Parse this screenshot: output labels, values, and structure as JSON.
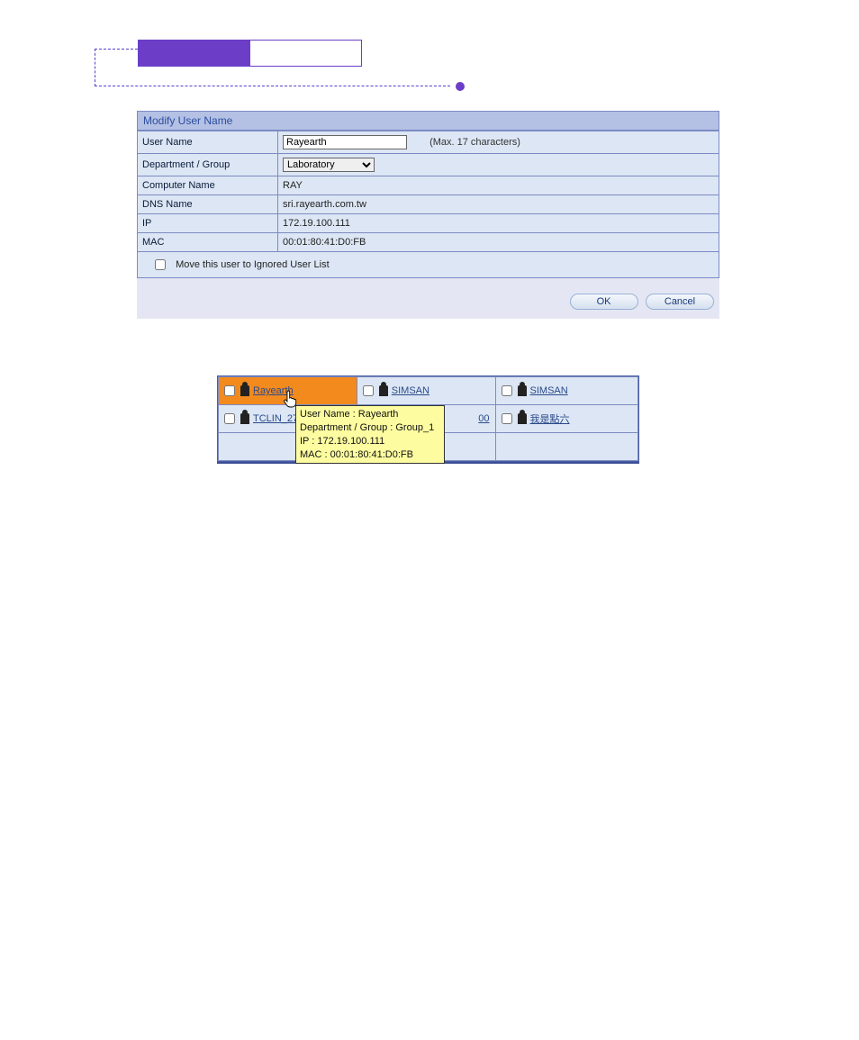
{
  "panel": {
    "title": "Modify User Name",
    "rows": {
      "user_name_label": "User Name",
      "user_name_value": "Rayearth",
      "user_name_hint": "(Max. 17 characters)",
      "dept_label": "Department / Group",
      "dept_value": "Laboratory",
      "computer_label": "Computer Name",
      "computer_value": "RAY",
      "dns_label": "DNS Name",
      "dns_value": "sri.rayearth.com.tw",
      "ip_label": "IP",
      "ip_value": "172.19.100.111",
      "mac_label": "MAC",
      "mac_value": "00:01:80:41:D0:FB",
      "ignore_label": "Move this user to Ignored User List"
    },
    "buttons": {
      "ok": "OK",
      "cancel": "Cancel"
    }
  },
  "grid": {
    "cells": [
      [
        "Rayearth",
        "SIMSAN",
        "SIMSAN"
      ],
      [
        "TCLIN_27",
        "00",
        "我是點六"
      ],
      [
        "",
        "",
        ""
      ]
    ]
  },
  "tooltip": {
    "line1": "User Name : Rayearth",
    "line2": "Department / Group : Group_1",
    "line3": "IP : 172.19.100.111",
    "line4": "MAC : 00:01:80:41:D0:FB"
  }
}
